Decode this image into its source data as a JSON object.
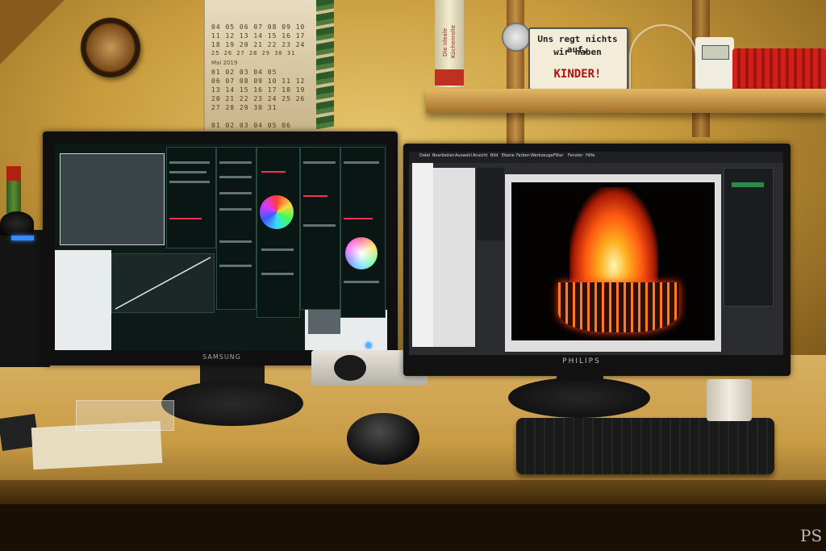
{
  "photo": {
    "subject": "dual-monitor desk setup",
    "signage": {
      "line1": "Uns regt nichts auf,",
      "line2": "wir haben",
      "line3": "KINDER!"
    },
    "paper_tube_label": "Die ideale Küchenrolle",
    "calendar": {
      "month_label": "Mai 2019",
      "rows_top": [
        "04 05 06 07 08 09 10",
        "11 12 13 14 15 16 17",
        "18 19 20 21 22 23 24",
        "25 26 27 28 29 30 31"
      ],
      "rows_bottom": [
        "01 02 03 04 05",
        "06 07 08 09 10 11 12",
        "13 14 15 16 17 18 19",
        "20 21 22 23 24 25 26",
        "27 28 29 30 31"
      ],
      "rows_next": [
        "01 02 03 04 05 06"
      ]
    },
    "left_monitor": {
      "brand": "SAMSUNG",
      "app": "color grading panels"
    },
    "right_monitor": {
      "brand": "PHILIPS",
      "title": "GIMP / image editor",
      "menu": [
        "Datei",
        "Bearbeiten",
        "Auswahl",
        "Ansicht",
        "Bild",
        "Ebene",
        "Farben",
        "Werkzeuge",
        "Filter",
        "Fenster",
        "Hilfe"
      ],
      "image": "fire basket at night"
    },
    "watermark": "PS",
    "colors": {
      "wall": "#d4a94e",
      "desk": "#c99b45",
      "fire": "#ff6a10",
      "led": "#3a8aff"
    }
  }
}
